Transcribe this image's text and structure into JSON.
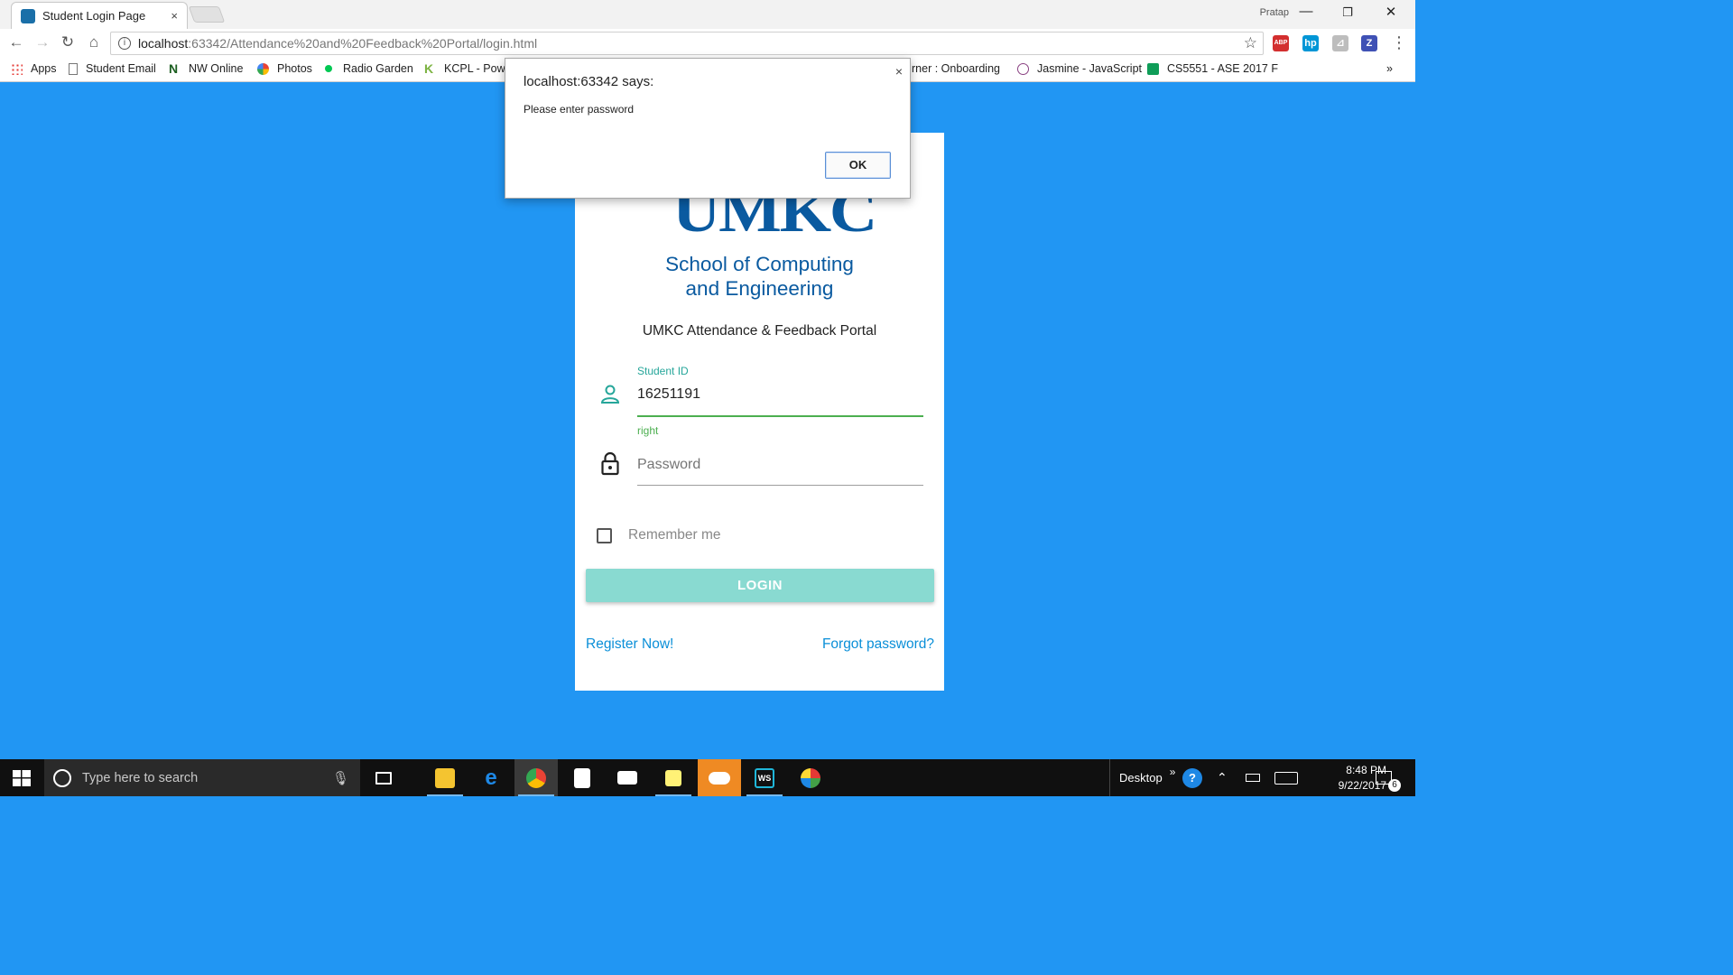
{
  "browser": {
    "tab_title": "Student Login Page",
    "tab_close": "×",
    "profile_name": "Pratap",
    "window_controls": {
      "minimize": "—",
      "restore": "❐",
      "close": "✕"
    },
    "nav": {
      "back": "←",
      "forward": "→",
      "reload": "↻",
      "home": "⌂"
    },
    "url_host": "localhost",
    "url_path": ":63342/Attendance%20and%20Feedback%20Portal/login.html",
    "star": "☆",
    "extensions": [
      {
        "name": "adblock-plus",
        "label": "ABP",
        "color": "#d32f2f"
      },
      {
        "name": "hp",
        "label": "hp",
        "color": "#0096d6"
      },
      {
        "name": "pdf",
        "label": "⊿",
        "color": "#bdbdbd"
      },
      {
        "name": "zotero",
        "label": "Z",
        "color": "#3f51b5"
      }
    ],
    "menu": "⋮",
    "bookmarks": [
      {
        "label": "Apps",
        "icon_color": "#e53935"
      },
      {
        "label": "Student Email",
        "icon_color": "#777777"
      },
      {
        "label": "NW Online",
        "icon_color": "#1b5e20"
      },
      {
        "label": "Photos",
        "icon_color": "#fbbc05"
      },
      {
        "label": "Radio Garden",
        "icon_color": "#00c853"
      },
      {
        "label": "KCPL - Powe",
        "icon_color": "#7cb342"
      },
      {
        "label": "rner : Onboarding",
        "icon_color": "#ffffff"
      },
      {
        "label": "Jasmine - JavaScript",
        "icon_color": "#8a4182"
      },
      {
        "label": "CS5551 - ASE 2017 F",
        "icon_color": "#0f9d58"
      }
    ],
    "bookmarks_more": "»"
  },
  "page": {
    "logo_text": "UMKC",
    "logo_sub_1": "School of Computing",
    "logo_sub_2": "and Engineering",
    "portal_title": "UMKC Attendance & Feedback Portal",
    "student_id_label": "Student ID",
    "student_id_value": "16251191",
    "student_id_help": "right",
    "password_placeholder": "Password",
    "remember_label": "Remember me",
    "login_label": "LOGIN",
    "register_link": "Register Now!",
    "forgot_link": "Forgot password?",
    "accent_color": "#26a69a",
    "background_color": "#2196f3"
  },
  "dialog": {
    "title": "localhost:63342 says:",
    "message": "Please enter password",
    "ok_label": "OK",
    "close": "×"
  },
  "taskbar": {
    "search_placeholder": "Type here to search",
    "apps": [
      {
        "name": "task-view",
        "active": false
      },
      {
        "name": "file-explorer",
        "active": false
      },
      {
        "name": "edge",
        "active": false
      },
      {
        "name": "chrome",
        "active": true
      },
      {
        "name": "store",
        "active": false
      },
      {
        "name": "mail",
        "active": false
      },
      {
        "name": "sticky-notes",
        "active": false
      },
      {
        "name": "onedrive",
        "active": true
      },
      {
        "name": "webstorm",
        "active": false
      },
      {
        "name": "paint",
        "active": false
      }
    ],
    "desktop_label": "Desktop",
    "tray_more": "»",
    "time": "8:48 PM",
    "date": "9/22/2017",
    "notifications": "6"
  }
}
